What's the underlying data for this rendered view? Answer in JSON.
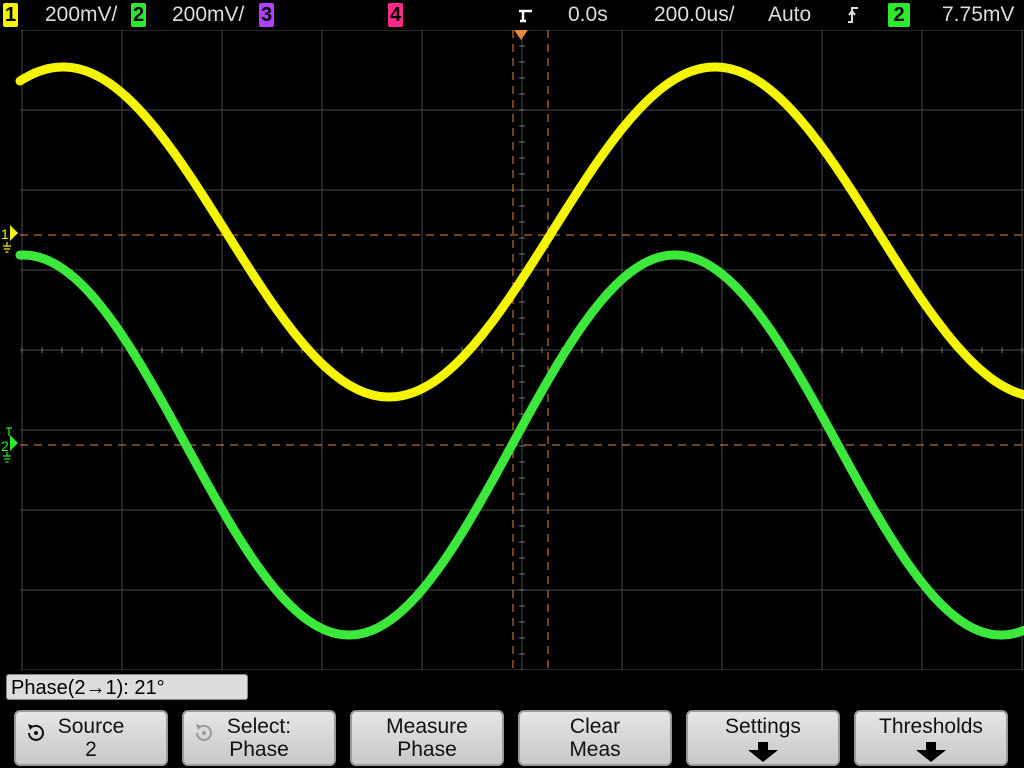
{
  "topbar": {
    "ch1": {
      "num": "1",
      "scale": "200mV/",
      "color": "#f5f500"
    },
    "ch2": {
      "num": "2",
      "scale": "200mV/",
      "color": "#2ee82e"
    },
    "ch3": {
      "num": "3",
      "color": "#b040ff"
    },
    "ch4": {
      "num": "4",
      "color": "#ff2a8a"
    },
    "delay": "0.0s",
    "timebase": "200.0us/",
    "trigger_mode": "Auto",
    "trigger_source": "2",
    "trigger_level": "7.75mV"
  },
  "markers": {
    "ch1": "1",
    "ch2": "2"
  },
  "measurement": {
    "readout": "Phase(2→1): 21°"
  },
  "softkeys": [
    {
      "line1": "Source",
      "line2": "2"
    },
    {
      "line1": "Select:",
      "line2": "Phase"
    },
    {
      "line1": "Measure",
      "line2": "Phase"
    },
    {
      "line1": "Clear",
      "line2": "Meas"
    },
    {
      "line1": "Settings",
      "line2": ""
    },
    {
      "line1": "Thresholds",
      "line2": ""
    }
  ],
  "colors": {
    "trace1": "#f5f500",
    "trace2": "#3de83d",
    "cursor": "#e08a3a",
    "grid": "#4a4a4a"
  }
}
